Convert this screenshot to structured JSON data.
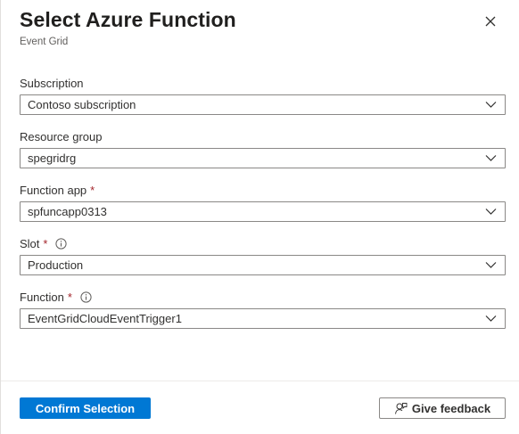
{
  "header": {
    "title": "Select Azure Function",
    "subtitle": "Event Grid",
    "close_icon": "close-icon"
  },
  "form": {
    "subscription": {
      "label": "Subscription",
      "value": "Contoso subscription",
      "required": false
    },
    "resource_group": {
      "label": "Resource group",
      "value": "spegridrg",
      "required": false
    },
    "function_app": {
      "label": "Function app",
      "value": "spfuncapp0313",
      "required": true
    },
    "slot": {
      "label": "Slot",
      "value": "Production",
      "required": true,
      "info": true
    },
    "function": {
      "label": "Function",
      "value": "EventGridCloudEventTrigger1",
      "required": true,
      "info": true
    },
    "required_marker": "*"
  },
  "footer": {
    "confirm_label": "Confirm Selection",
    "feedback_label": "Give feedback",
    "feedback_icon": "feedback-person-icon"
  },
  "colors": {
    "accent": "#0078d4",
    "required": "#a4262c",
    "border": "#8a8886"
  }
}
